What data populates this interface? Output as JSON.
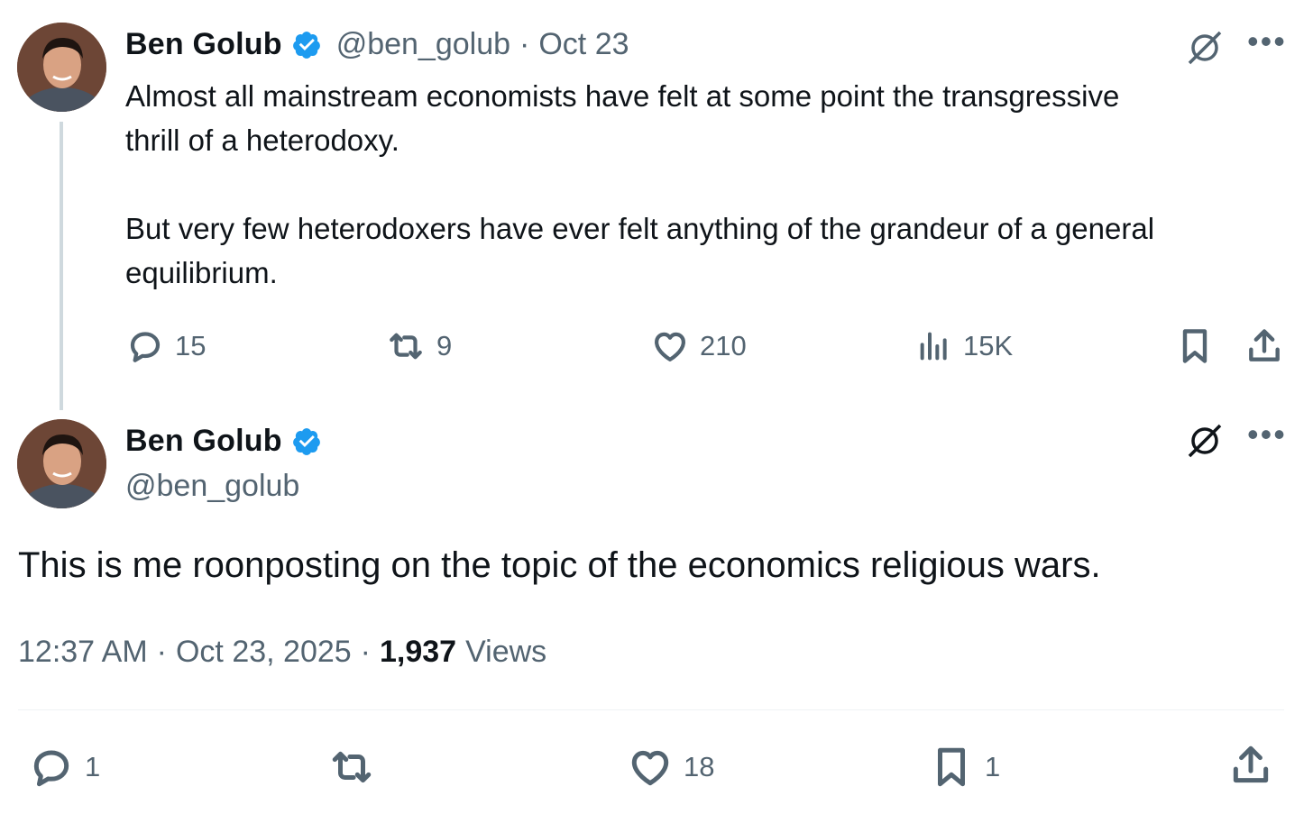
{
  "tweet1": {
    "name": "Ben Golub",
    "handle": "@ben_golub",
    "separator": "·",
    "date": "Oct 23",
    "text": "Almost all mainstream economists have felt at some point the transgressive\nthrill of a heterodoxy.\n\nBut very few heterodoxers have ever felt anything of the grandeur of a general\nequilibrium.",
    "replies": "15",
    "reposts": "9",
    "likes": "210",
    "views": "15K"
  },
  "tweet2": {
    "name": "Ben Golub",
    "handle": "@ben_golub",
    "text": "This is me roonposting on the topic of the economics religious wars.",
    "time": "12:37 AM",
    "sep1": "·",
    "date": "Oct 23, 2025",
    "sep2": "·",
    "views_count": "1,937",
    "views_label": "Views",
    "replies": "1",
    "likes": "18",
    "bookmarks": "1"
  },
  "colors": {
    "text": "#0f1419",
    "secondary": "#536471",
    "verified": "#1d9bf0",
    "thread_line": "#cfd9de"
  },
  "icons": [
    "grok-icon",
    "more-icon",
    "reply-icon",
    "repost-icon",
    "like-icon",
    "views-icon",
    "bookmark-icon",
    "share-icon",
    "verified-icon"
  ]
}
